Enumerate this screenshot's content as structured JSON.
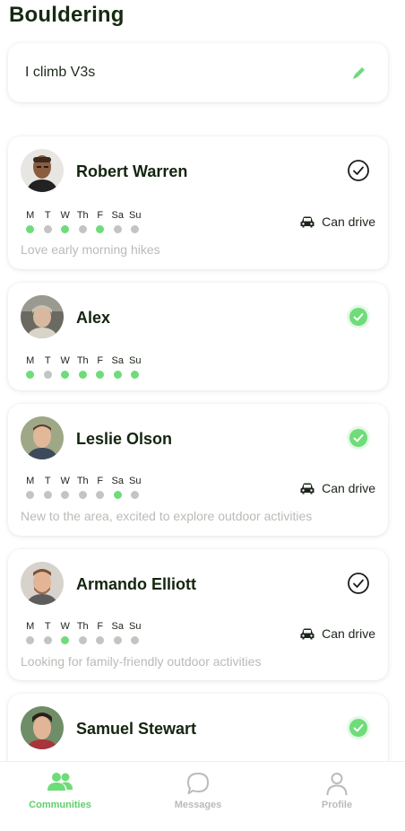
{
  "header": {
    "title": "Bouldering"
  },
  "status": {
    "text": "I climb V3s",
    "icon": "pencil-icon"
  },
  "colors": {
    "accent": "#6fdc7a",
    "inactive_dot": "#c4c4c4",
    "muted_text": "#b8bcb6",
    "tab_active": "#5fcf6a",
    "tab_inactive": "#b9bcb8"
  },
  "day_labels": [
    "M",
    "T",
    "W",
    "Th",
    "F",
    "Sa",
    "Su"
  ],
  "members": [
    {
      "name": "Robert Warren",
      "check": "outline",
      "days": [
        true,
        false,
        true,
        false,
        true,
        false,
        false
      ],
      "drive": "Can drive",
      "bio": "Love early morning hikes"
    },
    {
      "name": "Alex",
      "check": "filled",
      "days": [
        true,
        false,
        true,
        true,
        true,
        true,
        true
      ],
      "drive": "",
      "bio": ""
    },
    {
      "name": "Leslie Olson",
      "check": "filled",
      "days": [
        false,
        false,
        false,
        false,
        false,
        true,
        false
      ],
      "drive": "Can drive",
      "bio": "New to the area, excited to explore outdoor activities"
    },
    {
      "name": "Armando Elliott",
      "check": "outline",
      "days": [
        false,
        false,
        true,
        false,
        false,
        false,
        false
      ],
      "drive": "Can drive",
      "bio": "Looking for family-friendly outdoor activities"
    },
    {
      "name": "Samuel Stewart",
      "check": "filled",
      "days": [],
      "drive": "",
      "bio": ""
    }
  ],
  "tabs": [
    {
      "label": "Communities",
      "icon": "people-icon",
      "active": true
    },
    {
      "label": "Messages",
      "icon": "chat-bubble-icon",
      "active": false
    },
    {
      "label": "Profile",
      "icon": "person-icon",
      "active": false
    }
  ]
}
